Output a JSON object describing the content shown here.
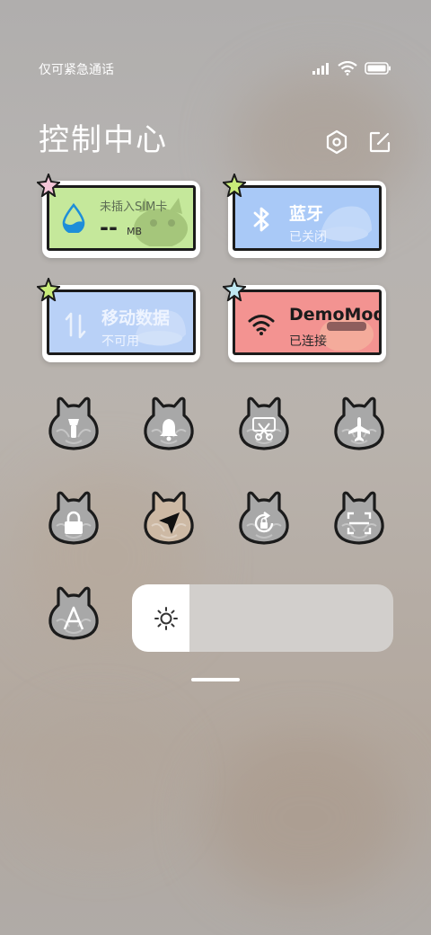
{
  "status_bar": {
    "carrier_text": "仅可紧急通话",
    "icons": [
      "signal-icon",
      "wifi-icon",
      "battery-icon"
    ]
  },
  "header": {
    "title": "控制中心",
    "icons": [
      "settings-icon",
      "edit-icon"
    ]
  },
  "tiles": {
    "data": {
      "line1": "未插入SIM卡",
      "value": "--",
      "unit": "MB",
      "color": "#c7e89a",
      "icon": "water-drop-icon"
    },
    "bluetooth": {
      "label": "蓝牙",
      "status": "已关闭",
      "color": "#a9c8f5",
      "icon": "bluetooth-icon"
    },
    "mobile_data": {
      "label": "移动数据",
      "status": "不可用",
      "color": "#b8d0f7",
      "icon": "data-arrows-icon"
    },
    "wifi": {
      "label": "DemoMod",
      "status": "已连接",
      "color": "#f2908e",
      "icon": "wifi-icon"
    }
  },
  "toggles": [
    {
      "name": "flashlight",
      "icon": "flashlight-icon",
      "active": false
    },
    {
      "name": "ringer",
      "icon": "bell-icon",
      "active": false
    },
    {
      "name": "screenshot",
      "icon": "scissors-icon",
      "active": false
    },
    {
      "name": "airplane",
      "icon": "airplane-icon",
      "active": false
    },
    {
      "name": "lock-screen",
      "icon": "lock-icon",
      "active": false
    },
    {
      "name": "location",
      "icon": "location-arrow-icon",
      "active": true
    },
    {
      "name": "auto-rotate",
      "icon": "rotate-lock-icon",
      "active": false
    },
    {
      "name": "scanner",
      "icon": "scan-icon",
      "active": false
    },
    {
      "name": "auto-brightness",
      "icon": "letter-a-icon",
      "active": false
    }
  ],
  "brightness": {
    "level": 0.22,
    "icon": "sun-icon"
  },
  "colors": {
    "title": "#ffffff",
    "cat_fill": "#a8a8a8",
    "cat_active": "#cdb9a4",
    "outline": "#1b1b1b"
  }
}
